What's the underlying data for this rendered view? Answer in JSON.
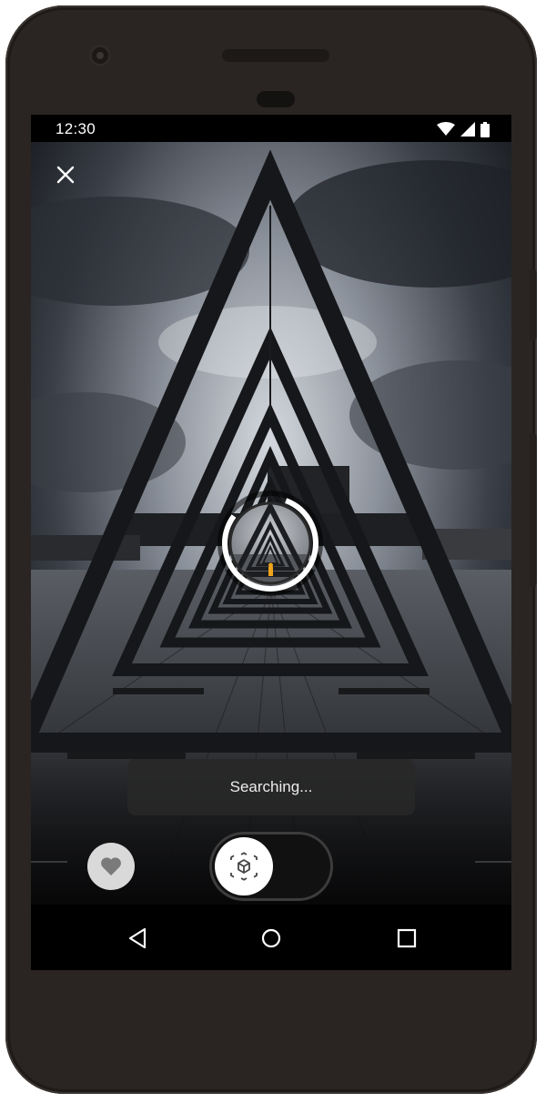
{
  "status_bar": {
    "time": "12:30",
    "icons": [
      "wifi-icon",
      "cellular-signal-icon",
      "battery-icon"
    ]
  },
  "top_bar": {
    "close_icon": "close-icon"
  },
  "scene": {
    "description_icon": "photo-preview",
    "search_indicator_icon": "loading-ring-icon"
  },
  "toast": {
    "message": "Searching..."
  },
  "controls": {
    "favorite_icon": "heart-icon",
    "mode_icon": "3d-cube-icon",
    "mode_toggle_on": false
  },
  "nav_bar": {
    "back_icon": "back-triangle-icon",
    "home_icon": "home-circle-icon",
    "recents_icon": "recents-square-icon"
  },
  "colors": {
    "phone_body": "#2a2523",
    "toast_bg": "#282828",
    "accent_white": "#ffffff"
  }
}
